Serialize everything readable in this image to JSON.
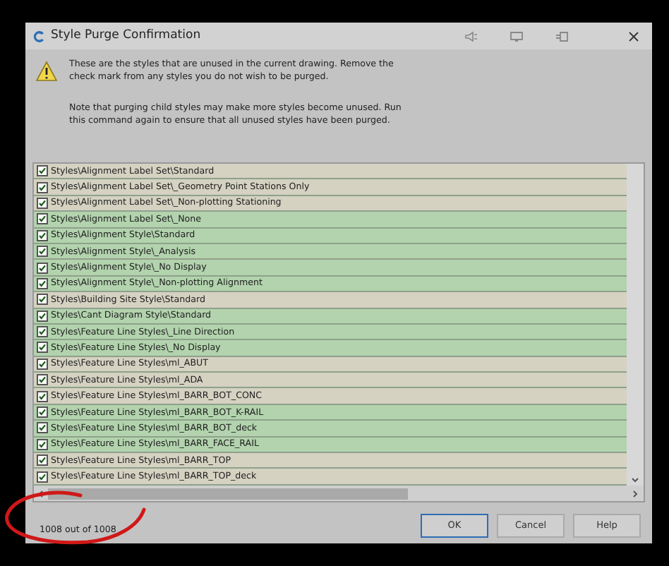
{
  "window": {
    "title": "Style Purge Confirmation"
  },
  "message": [
    "These are the styles that are unused in the current drawing.  Remove the check mark from any styles you do not wish to be purged.",
    "Note that purging child styles may make more styles become unused.  Run this command again to ensure that all unused styles have been purged."
  ],
  "styles": [
    {
      "label": "Styles\\Alignment Label Set\\Standard",
      "checked": true,
      "color": "#d5d2c2"
    },
    {
      "label": "Styles\\Alignment Label Set\\_Geometry Point Stations Only",
      "checked": true,
      "color": "#d5d2c2"
    },
    {
      "label": "Styles\\Alignment Label Set\\_Non-plotting Stationing",
      "checked": true,
      "color": "#d5d2c2"
    },
    {
      "label": "Styles\\Alignment Label Set\\_None",
      "checked": true,
      "color": "#b2d3ad"
    },
    {
      "label": "Styles\\Alignment Style\\Standard",
      "checked": true,
      "color": "#b2d3ad"
    },
    {
      "label": "Styles\\Alignment Style\\_Analysis",
      "checked": true,
      "color": "#b2d3ad"
    },
    {
      "label": "Styles\\Alignment Style\\_No Display",
      "checked": true,
      "color": "#b2d3ad"
    },
    {
      "label": "Styles\\Alignment Style\\_Non-plotting Alignment",
      "checked": true,
      "color": "#b2d3ad"
    },
    {
      "label": "Styles\\Building Site Style\\Standard",
      "checked": true,
      "color": "#d5d2c2"
    },
    {
      "label": "Styles\\Cant Diagram Style\\Standard",
      "checked": true,
      "color": "#b2d3ad"
    },
    {
      "label": "Styles\\Feature Line Styles\\_Line Direction",
      "checked": true,
      "color": "#b2d3ad"
    },
    {
      "label": "Styles\\Feature Line Styles\\_No Display",
      "checked": true,
      "color": "#b2d3ad"
    },
    {
      "label": "Styles\\Feature Line Styles\\ml_ABUT",
      "checked": true,
      "color": "#d5d2c2"
    },
    {
      "label": "Styles\\Feature Line Styles\\ml_ADA",
      "checked": true,
      "color": "#d5d2c2"
    },
    {
      "label": "Styles\\Feature Line Styles\\ml_BARR_BOT_CONC",
      "checked": true,
      "color": "#d5d2c2"
    },
    {
      "label": "Styles\\Feature Line Styles\\ml_BARR_BOT_K-RAIL",
      "checked": true,
      "color": "#b2d3ad"
    },
    {
      "label": "Styles\\Feature Line Styles\\ml_BARR_BOT_deck",
      "checked": true,
      "color": "#b2d3ad"
    },
    {
      "label": "Styles\\Feature Line Styles\\ml_BARR_FACE_RAIL",
      "checked": true,
      "color": "#b2d3ad"
    },
    {
      "label": "Styles\\Feature Line Styles\\ml_BARR_TOP",
      "checked": true,
      "color": "#d5d2c2"
    },
    {
      "label": "Styles\\Feature Line Styles\\ml_BARR_TOP_deck",
      "checked": true,
      "color": "#d5d2c2"
    }
  ],
  "count": "1008 out of 1008",
  "buttons": [
    {
      "label": "OK",
      "selected": true
    },
    {
      "label": "Cancel",
      "selected": false
    },
    {
      "label": "Help",
      "selected": false
    }
  ]
}
